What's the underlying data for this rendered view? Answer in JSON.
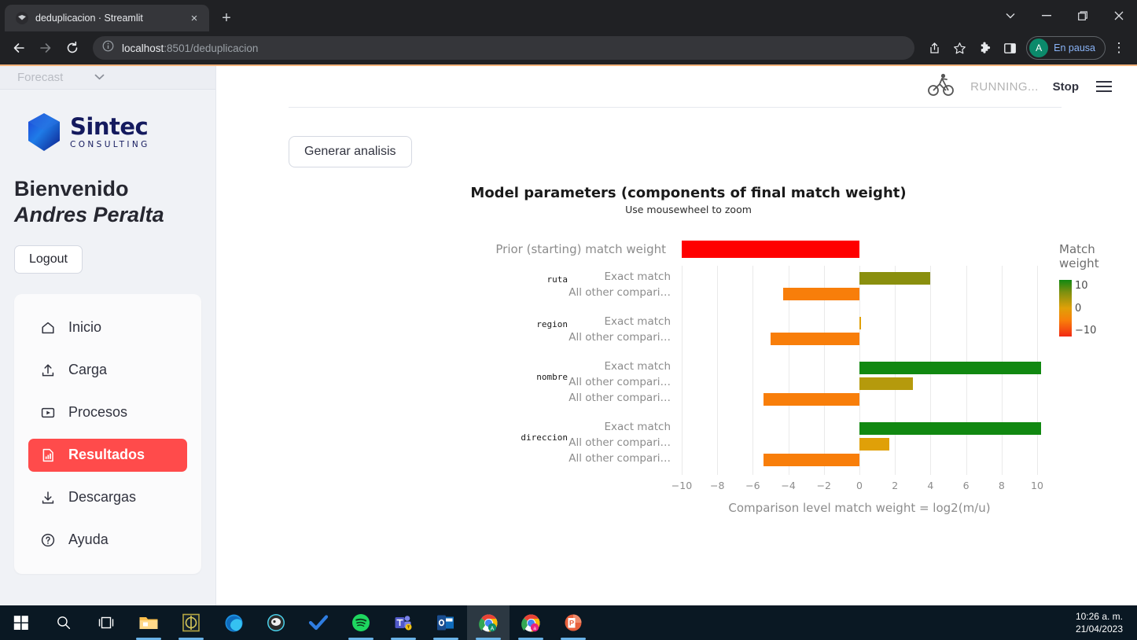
{
  "browser": {
    "tab": {
      "title": "deduplicacion · Streamlit",
      "favicon": "streamlit-favicon",
      "close": "×"
    },
    "new_tab": "+",
    "window_controls": {
      "expand": "⌄",
      "minimize": "—",
      "restore": "❐",
      "close": "✕"
    },
    "nav": {
      "back": "←",
      "forward": "→",
      "reload": "⟳"
    },
    "omnibox": {
      "info_icon": "ⓘ",
      "url_host": "localhost",
      "url_rest": ":8501/deduplicacion",
      "full_url": "localhost:8501/deduplicacion"
    },
    "toolbar_icons": [
      "share-icon",
      "bookmark-star-icon",
      "extensions-puzzle-icon",
      "side-panel-icon"
    ],
    "profile": {
      "initial": "A",
      "label": "En pausa"
    },
    "menu": "⋮"
  },
  "sidebar": {
    "forecast_select": {
      "label": "Forecast",
      "caret": "⌄"
    },
    "logo": {
      "name": "Sintec",
      "subtitle": "CONSULTING"
    },
    "welcome": {
      "greeting": "Bienvenido ",
      "user": "Andres Peralta"
    },
    "logout_label": "Logout",
    "items": [
      {
        "label": "Inicio",
        "icon": "home-icon",
        "active": false
      },
      {
        "label": "Carga",
        "icon": "upload-icon",
        "active": false
      },
      {
        "label": "Procesos",
        "icon": "play-box-icon",
        "active": false
      },
      {
        "label": "Resultados",
        "icon": "bar-chart-file-icon",
        "active": true
      },
      {
        "label": "Descargas",
        "icon": "download-icon",
        "active": false
      },
      {
        "label": "Ayuda",
        "icon": "help-circle-icon",
        "active": false
      }
    ],
    "active_color": "#ff4b4b"
  },
  "main": {
    "status": {
      "icon": "running-man-icon",
      "text": "RUNNING...",
      "stop_label": "Stop",
      "menu": "hamburger-icon"
    },
    "generate_button": "Generar analisis"
  },
  "chart_data": {
    "type": "bar",
    "title": "Model parameters (components of final match weight)",
    "subtitle": "Use mousewheel to zoom",
    "xlabel": "Comparison level match weight = log2(m/u)",
    "ylabel": "",
    "xlim": [
      -10,
      10
    ],
    "xticks": [
      -10,
      -8,
      -6,
      -4,
      -2,
      0,
      2,
      4,
      6,
      8,
      10
    ],
    "xticklabels": [
      "−10",
      "−8",
      "−6",
      "−4",
      "−2",
      "0",
      "2",
      "4",
      "6",
      "8",
      "10"
    ],
    "grid": true,
    "orientation": "horizontal",
    "legend": {
      "title": "Match weight",
      "position": "right",
      "type": "colorbar",
      "ticks": [
        10,
        0,
        -10
      ],
      "ticklabels": [
        "10",
        "0",
        "−10"
      ],
      "colors": {
        "high": "#118811",
        "mid": "#e0a008",
        "low": "#f22a14"
      }
    },
    "prior": {
      "label": "Prior (starting) match weight",
      "value": -10,
      "display_start": -10,
      "color": "#ff0000"
    },
    "groups": [
      {
        "name": "ruta",
        "levels": [
          {
            "label": "Exact match",
            "value": 4.0,
            "color": "#8a8f0e"
          },
          {
            "label": "All other compari…",
            "value": -4.3,
            "color": "#f87e0a"
          }
        ]
      },
      {
        "name": "region",
        "levels": [
          {
            "label": "Exact match",
            "value": 0.1,
            "color": "#e0a008"
          },
          {
            "label": "All other compari…",
            "value": -5.0,
            "color": "#f87e0a"
          }
        ]
      },
      {
        "name": "nombre",
        "levels": [
          {
            "label": "Exact match",
            "value": 10.2,
            "color": "#118811"
          },
          {
            "label": "All other compari…",
            "value": 3.0,
            "color": "#b59a0c"
          },
          {
            "label": "All other compari…2",
            "value": -5.4,
            "color": "#f87e0a"
          }
        ]
      },
      {
        "name": "direccion",
        "levels": [
          {
            "label": "Exact match",
            "value": 10.2,
            "color": "#118811"
          },
          {
            "label": "All other compari…",
            "value": 1.7,
            "color": "#e0a008"
          },
          {
            "label": "All other compari…2",
            "value": -5.4,
            "color": "#f87e0a"
          }
        ]
      }
    ]
  },
  "taskbar": {
    "items": [
      {
        "name": "start-button",
        "icon": "windows-logo"
      },
      {
        "name": "search-button",
        "icon": "magnifier"
      },
      {
        "name": "task-view-button",
        "icon": "task-view"
      },
      {
        "name": "file-explorer",
        "icon": "folder",
        "running": true
      },
      {
        "name": "app-olive",
        "icon": "olive-app",
        "running": true
      },
      {
        "name": "microsoft-edge",
        "icon": "edge",
        "running": false
      },
      {
        "name": "app-dark-circle",
        "icon": "dark-circle-app",
        "running": false
      },
      {
        "name": "microsoft-todo",
        "icon": "blue-check",
        "running": false
      },
      {
        "name": "spotify",
        "icon": "spotify",
        "running": true
      },
      {
        "name": "microsoft-teams",
        "icon": "teams",
        "running": true
      },
      {
        "name": "microsoft-outlook",
        "icon": "outlook",
        "running": true
      },
      {
        "name": "google-chrome-a",
        "icon": "chrome-a",
        "running": true,
        "active": true
      },
      {
        "name": "google-chrome-b",
        "icon": "chrome-b",
        "running": true
      },
      {
        "name": "microsoft-powerpoint",
        "icon": "powerpoint",
        "running": true
      }
    ],
    "clock": {
      "time": "10:26 a. m.",
      "date": "21/04/2023"
    }
  }
}
